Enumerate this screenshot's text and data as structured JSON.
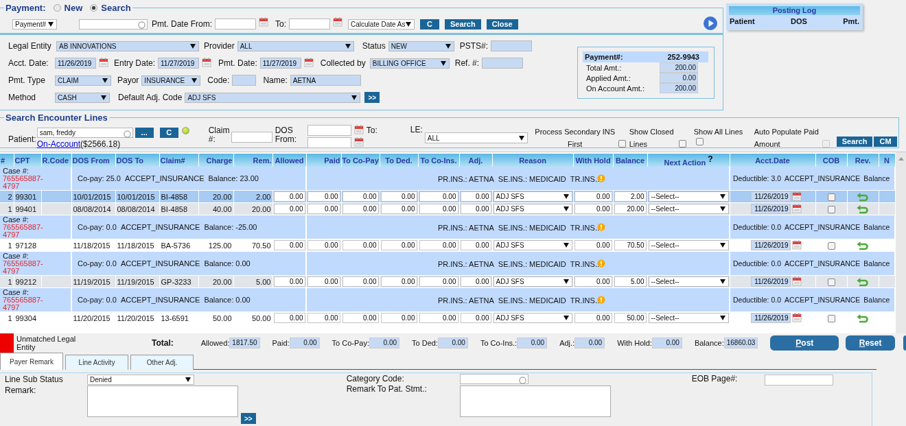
{
  "payment_mode": {
    "label": "Payment:",
    "options": [
      {
        "label": "New",
        "selected": false
      },
      {
        "label": "Search",
        "selected": true
      }
    ]
  },
  "search_bar": {
    "search_by": "Payment#",
    "date_from_label": "Pmt. Date From:",
    "to_label": "To:",
    "calculate": "Calculate Date As",
    "buttons": [
      "C",
      "Search",
      "Close"
    ]
  },
  "posting_log": {
    "title": "Posting Log",
    "columns": [
      "Patient",
      "DOS",
      "Pmt."
    ]
  },
  "details": {
    "legal_entity": {
      "label": "Legal Entity",
      "value": "AB INNOVATIONS"
    },
    "provider": {
      "label": "Provider",
      "value": "ALL"
    },
    "status": {
      "label": "Status",
      "value": "NEW"
    },
    "psts": {
      "label": "PSTS#:"
    },
    "acct_date": {
      "label": "Acct. Date:",
      "value": "11/26/2019"
    },
    "entry_date": {
      "label": "Entry Date:",
      "value": "11/27/2019"
    },
    "pmt_date": {
      "label": "Pmt. Date:",
      "value": "11/27/2019"
    },
    "collected_by": {
      "label": "Collected by",
      "value": "BILLING OFFICE"
    },
    "ref": {
      "label": "Ref. #:"
    },
    "pmt_type": {
      "label": "Pmt. Type",
      "value": "CLAIM"
    },
    "payor": {
      "label": "Payor",
      "value": "INSURANCE"
    },
    "code": {
      "label": "Code:"
    },
    "name": {
      "label": "Name:",
      "value": "AETNA"
    },
    "method": {
      "label": "Method",
      "value": "CASH"
    },
    "default_adj_code": {
      "label": "Default Adj. Code",
      "value": "ADJ SFS"
    },
    "apply_button": ">>"
  },
  "payment_summary": {
    "label": "Payment#:",
    "number": "252-9943",
    "amounts": [
      {
        "label": "Total Amt.:",
        "value": "200.00"
      },
      {
        "label": "Applied Amt.:",
        "value": "0.00"
      },
      {
        "label": "On Account Amt.:",
        "value": "200.00"
      }
    ]
  },
  "encounter_search": {
    "title": "Search Encounter Lines",
    "patient_label": "Patient:",
    "patient": "sam, freddy",
    "lookup_button": "...",
    "clear_button": "C",
    "account_link": "On-Account",
    "account_amount": "($2566.18)",
    "claim_label": "Claim #:",
    "dos_from_label": "DOS From:",
    "to_label": "To:",
    "le_label": "LE:",
    "le": "ALL",
    "options": [
      {
        "label": "Process Secondary INS First",
        "checked": false,
        "disabled": false
      },
      {
        "label": "Show Closed Lines",
        "checked": false,
        "disabled": false
      },
      {
        "label": "Show All Lines",
        "checked": false,
        "disabled": false
      },
      {
        "label": "Auto Populate Paid Amount",
        "checked": false,
        "disabled": true
      }
    ],
    "buttons": [
      "Search",
      "CM"
    ]
  },
  "table": {
    "columns": [
      "#",
      "CPT",
      "R.Code",
      "DOS From",
      "DOS To",
      "Claim#",
      "Charge",
      "Rem.",
      "Allowed",
      "Paid",
      "To Co-Pay",
      "To Ded.",
      "To Co-Ins.",
      "Adj.",
      "Reason",
      "With Hold",
      "Balance",
      "Next Action",
      "Acct.Date",
      "COB",
      "Rev.",
      "N"
    ],
    "help_mark": "?",
    "rows": [
      {
        "kind": "case",
        "label": "Case #:",
        "case_number": "765565887-4797",
        "copay": "Co-pay: 25.0",
        "acceptance": "ACCEPT_INSURANCE",
        "balance": "Balance: 23.00",
        "primary": "PR.INS.: AETNA",
        "secondary": "SE.INS.: MEDICAID",
        "tertiary": "TR.INS.:",
        "deductible": "Deductible: 3.0",
        "acceptance_2": "ACCEPT_INSURANCE",
        "balance_2": "Balance"
      },
      {
        "kind": "line",
        "selected": true,
        "number": "2",
        "cpt": "99301",
        "dos_from": "10/01/2015",
        "dos_to": "10/01/2015",
        "claim": "BI-4858",
        "charge": "20.00",
        "rem": "2.00",
        "amounts": [
          "0.00",
          "0.00",
          "0.00",
          "0.00",
          "0.00",
          "0.00"
        ],
        "reason": "ADJ SFS",
        "with_hold": "0.00",
        "balance": "2.00",
        "next_action": "--Select--",
        "acct_date": "11/26/2019",
        "cob": false
      },
      {
        "kind": "line",
        "selected": false,
        "number": "1",
        "cpt": "99401",
        "dos_from": "08/08/2014",
        "dos_to": "08/08/2014",
        "claim": "BI-4858",
        "charge": "40.00",
        "rem": "20.00",
        "amounts": [
          "0.00",
          "0.00",
          "0.00",
          "0.00",
          "0.00",
          "0.00"
        ],
        "reason": "ADJ SFS",
        "with_hold": "0.00",
        "balance": "20.00",
        "next_action": "--Select--",
        "acct_date": "11/26/2019",
        "cob": false
      },
      {
        "kind": "case",
        "label": "Case #:",
        "case_number": "765565887-4797",
        "copay": "Co-pay: 0.0",
        "acceptance": "ACCEPT_INSURANCE",
        "balance": "Balance: -25.00",
        "primary": "PR.INS.: AETNA",
        "secondary": "SE.INS.: MEDICAID",
        "tertiary": "TR.INS.:",
        "deductible": "Deductible: 0.0",
        "acceptance_2": "ACCEPT_INSURANCE",
        "balance_2": "Balance"
      },
      {
        "kind": "line",
        "selected": false,
        "number": "1",
        "cpt": "97128",
        "dos_from": "11/18/2015",
        "dos_to": "11/18/2015",
        "claim": "BA-5736",
        "charge": "125.00",
        "rem": "70.50",
        "amounts": [
          "0.00",
          "0.00",
          "0.00",
          "0.00",
          "0.00",
          "0.00"
        ],
        "reason": "ADJ SFS",
        "with_hold": "0.00",
        "balance": "70.50",
        "next_action": "--Select--",
        "acct_date": "11/26/2019",
        "cob": false
      },
      {
        "kind": "case",
        "label": "Case #:",
        "case_number": "765565887-4797",
        "copay": "Co-pay: 0.0",
        "acceptance": "ACCEPT_INSURANCE",
        "balance": "Balance: 0.00",
        "primary": "PR.INS.: AETNA",
        "secondary": "SE.INS.: MEDICAID",
        "tertiary": "TR.INS.:",
        "deductible": "Deductible: 0.0",
        "acceptance_2": "ACCEPT_INSURANCE",
        "balance_2": "Balance"
      },
      {
        "kind": "line",
        "selected": false,
        "number": "1",
        "cpt": "99212",
        "dos_from": "11/19/2015",
        "dos_to": "11/19/2015",
        "claim": "GP-3233",
        "charge": "20.00",
        "rem": "5.00",
        "amounts": [
          "0.00",
          "0.00",
          "0.00",
          "0.00",
          "0.00",
          "0.00"
        ],
        "reason": "ADJ SFS",
        "with_hold": "0.00",
        "balance": "5.00",
        "next_action": "--Select--",
        "acct_date": "11/26/2019",
        "cob": false
      },
      {
        "kind": "case",
        "label": "Case #:",
        "case_number": "765565887-4797",
        "copay": "Co-pay: 0.0",
        "acceptance": "ACCEPT_INSURANCE",
        "balance": "Balance: 0.00",
        "primary": "PR.INS.: AETNA",
        "secondary": "SE.INS.: MEDICAID",
        "tertiary": "TR.INS.:",
        "deductible": "Deductible: 0.0",
        "acceptance_2": "ACCEPT_INSURANCE",
        "balance_2": "Balance"
      },
      {
        "kind": "line",
        "selected": false,
        "number": "1",
        "cpt": "99304",
        "dos_from": "11/20/2015",
        "dos_to": "11/20/2015",
        "claim": "13-6591",
        "charge": "50.00",
        "rem": "50.00",
        "amounts": [
          "0.00",
          "0.00",
          "0.00",
          "0.00",
          "0.00",
          "0.00"
        ],
        "reason": "ADJ SFS",
        "with_hold": "0.00",
        "balance": "50.00",
        "next_action": "--Select--",
        "acct_date": "11/26/2019",
        "cob": false
      }
    ]
  },
  "totals": {
    "legend": "Unmatched Legal Entity",
    "label": "Total:",
    "items": [
      {
        "label": "Allowed:",
        "value": "1817.50"
      },
      {
        "label": "Paid:",
        "value": "0.00"
      },
      {
        "label": "To Co-Pay:",
        "value": "0.00"
      },
      {
        "label": "To Ded:",
        "value": "0.00"
      },
      {
        "label": "To Co-Ins.:",
        "value": "0.00"
      },
      {
        "label": "Adj.:",
        "value": "0.00"
      },
      {
        "label": "With Hold:",
        "value": "0.00"
      },
      {
        "label": "Balance:",
        "value": "16860.03"
      }
    ],
    "buttons": [
      "Post",
      "Reset"
    ]
  },
  "tabs": [
    {
      "label": "Payer Remark",
      "selected": true
    },
    {
      "label": "Line Activity",
      "selected": false
    },
    {
      "label": "Other Adj.",
      "selected": false
    }
  ],
  "remark_panel": {
    "sub_status_label": "Line Sub Status",
    "sub_status": "Denied",
    "remark_label": "Remark:",
    "apply_button": ">>",
    "category_label": "Category Code:",
    "pat_stmt_label": "Remark To Pat. Stmt.:",
    "eob_label": "EOB Page#:"
  }
}
